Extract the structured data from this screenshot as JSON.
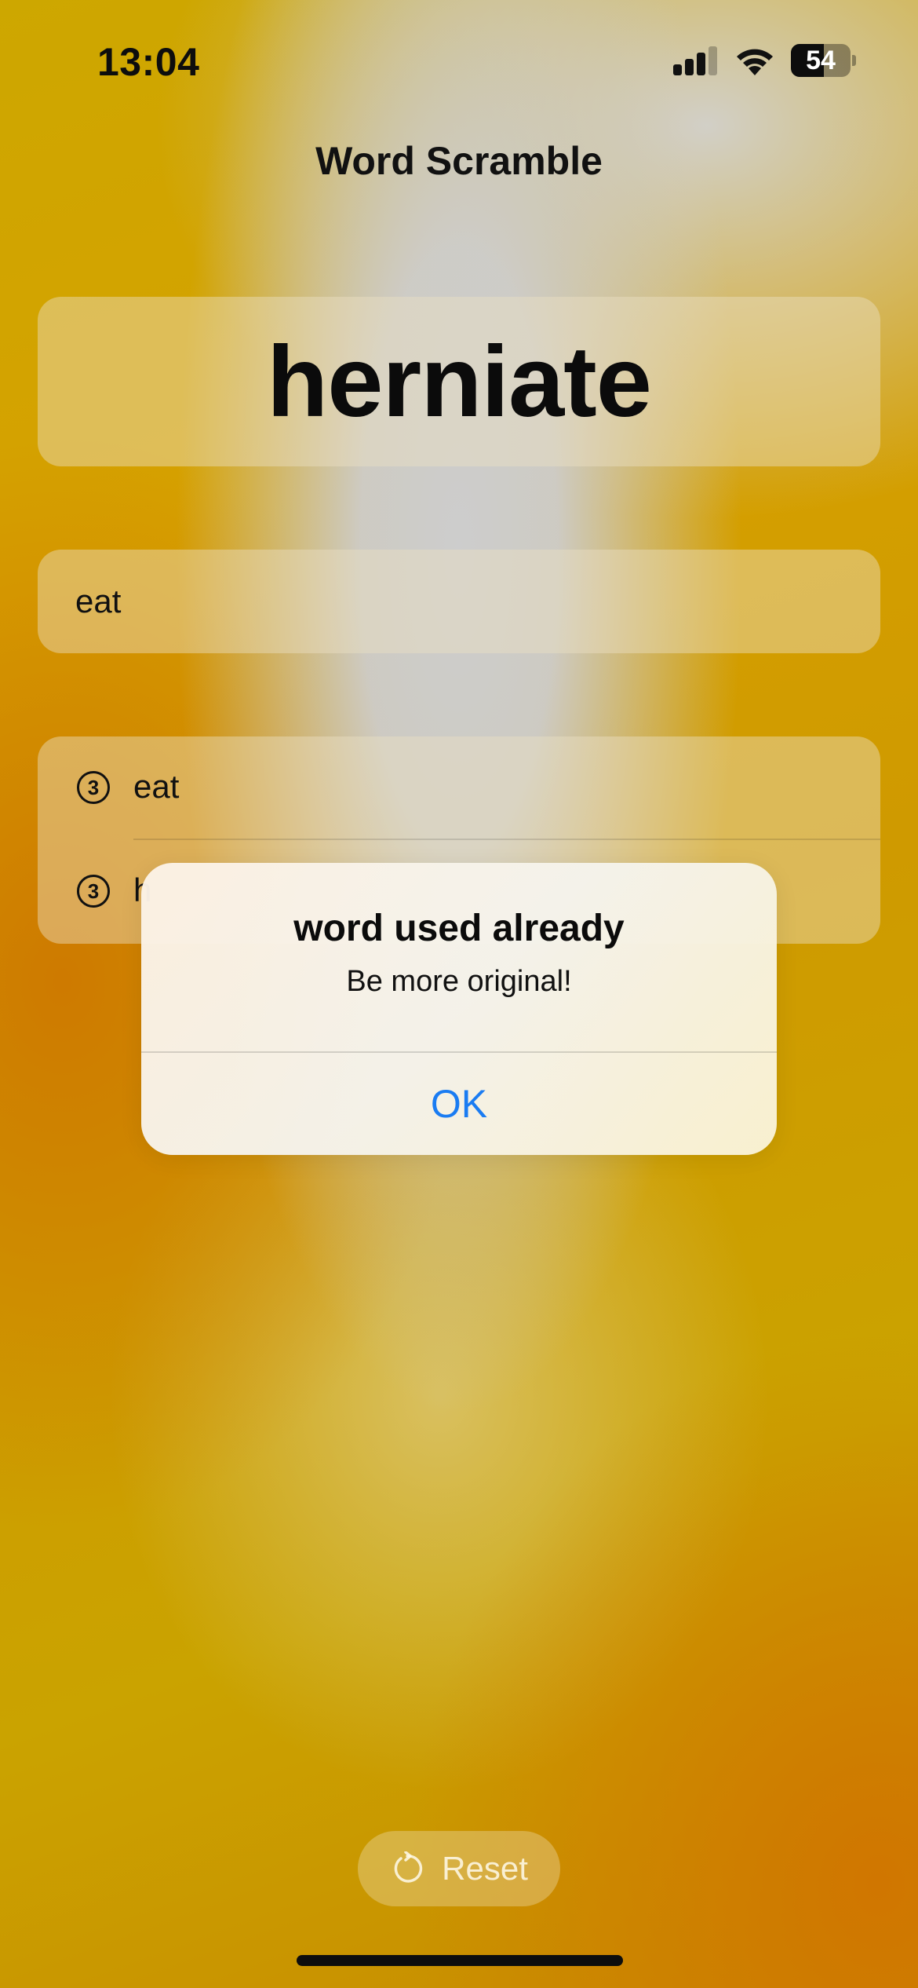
{
  "status_bar": {
    "time": "13:04",
    "battery_level": "54",
    "icons": [
      "cellular-signal-icon",
      "wifi-icon",
      "battery-icon"
    ]
  },
  "nav": {
    "title": "Word Scramble"
  },
  "root_word": "herniate",
  "input": {
    "value": "eat",
    "placeholder": ""
  },
  "used_words": [
    {
      "count": "3",
      "word": "eat"
    },
    {
      "count": "3",
      "word": "h"
    }
  ],
  "alert": {
    "title": "word used already",
    "message": "Be more original!",
    "button_label": "OK",
    "button_color": "#1a7cf2"
  },
  "reset": {
    "label": "Reset",
    "icon": "reset-arrow-icon"
  }
}
